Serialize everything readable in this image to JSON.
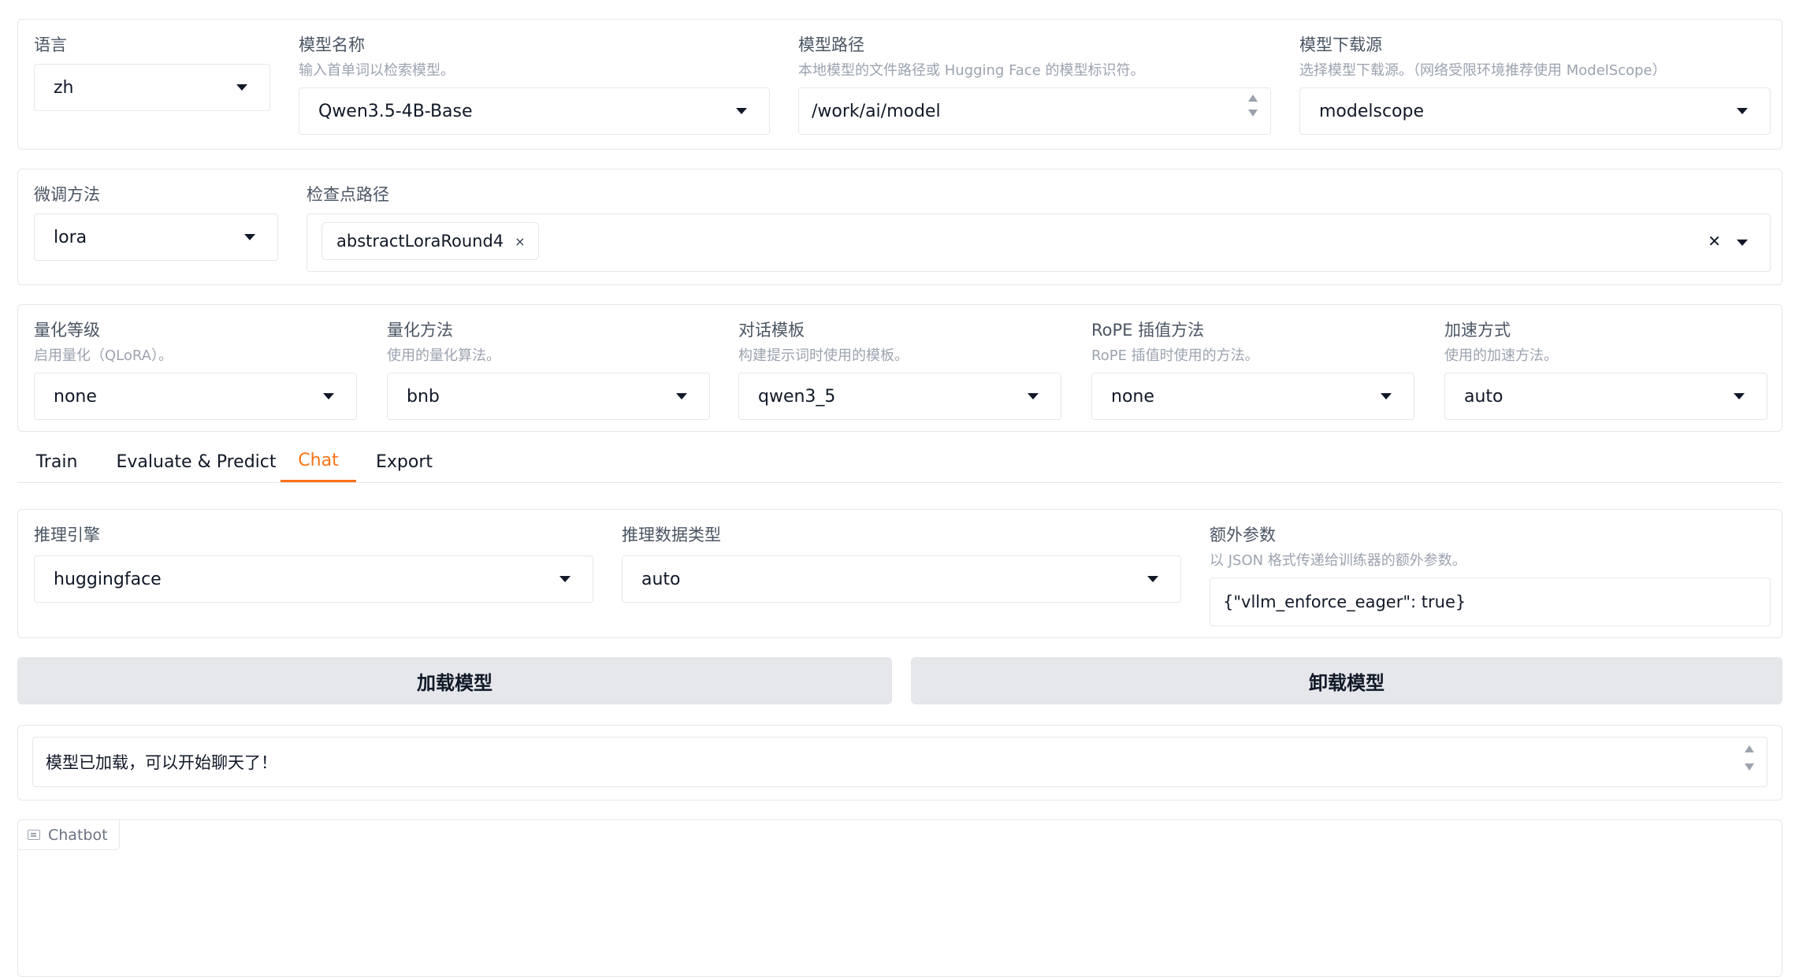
{
  "top": {
    "language": {
      "label": "语言",
      "value": "zh"
    },
    "model_name": {
      "label": "模型名称",
      "hint": "输入首单词以检索模型。",
      "value": "Qwen3.5-4B-Base"
    },
    "model_path": {
      "label": "模型路径",
      "hint": "本地模型的文件路径或 Hugging Face 的模型标识符。",
      "value": "/work/ai/model"
    },
    "hub": {
      "label": "模型下载源",
      "hint": "选择模型下载源。（网络受限环境推荐使用 ModelScope）",
      "value": "modelscope"
    }
  },
  "finetune": {
    "method": {
      "label": "微调方法",
      "value": "lora"
    },
    "checkpoint": {
      "label": "检查点路径",
      "chips": [
        "abstractLoraRound4"
      ],
      "chip_remove": "×",
      "clear": "✕"
    }
  },
  "advanced": {
    "quant_bit": {
      "label": "量化等级",
      "hint": "启用量化（QLoRA）。",
      "value": "none"
    },
    "quant_method": {
      "label": "量化方法",
      "hint": "使用的量化算法。",
      "value": "bnb"
    },
    "template": {
      "label": "对话模板",
      "hint": "构建提示词时使用的模板。",
      "value": "qwen3_5"
    },
    "rope": {
      "label": "RoPE 插值方法",
      "hint": "RoPE 插值时使用的方法。",
      "value": "none"
    },
    "booster": {
      "label": "加速方式",
      "hint": "使用的加速方法。",
      "value": "auto"
    }
  },
  "tabs": [
    {
      "label": "Train",
      "active": false
    },
    {
      "label": "Evaluate & Predict",
      "active": false
    },
    {
      "label": "Chat",
      "active": true
    },
    {
      "label": "Export",
      "active": false
    }
  ],
  "infer": {
    "backend": {
      "label": "推理引擎",
      "value": "huggingface"
    },
    "dtype": {
      "label": "推理数据类型",
      "value": "auto"
    },
    "extra": {
      "label": "额外参数",
      "hint": "以 JSON 格式传递给训练器的额外参数。",
      "value": "{\"vllm_enforce_eager\": true}"
    }
  },
  "buttons": {
    "load": "加载模型",
    "unload": "卸载模型"
  },
  "info_box": {
    "value": "模型已加载，可以开始聊天了！"
  },
  "chatbot": {
    "label": "Chatbot"
  },
  "colors": {
    "accent": "#f97316",
    "border": "#e5e7eb",
    "button_bg": "#e5e7eb"
  }
}
